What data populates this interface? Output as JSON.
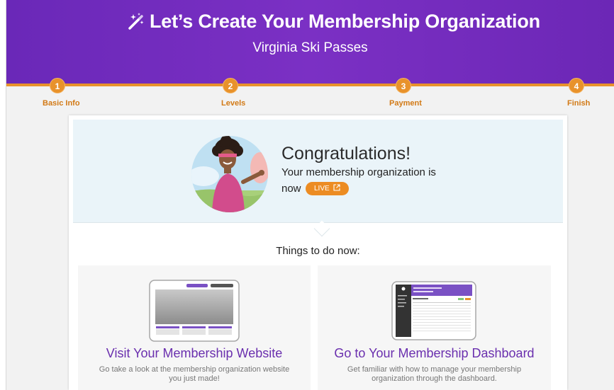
{
  "header": {
    "title": "Let’s Create Your Membership Organization",
    "subtitle": "Virginia Ski Passes",
    "title_icon": "magic-wand-icon"
  },
  "steps": [
    {
      "number": "1",
      "label": "Basic Info"
    },
    {
      "number": "2",
      "label": "Levels"
    },
    {
      "number": "3",
      "label": "Payment"
    },
    {
      "number": "4",
      "label": "Finish"
    }
  ],
  "hero": {
    "heading": "Congratulations!",
    "line1": "Your membership organization is",
    "line2_prefix": "now",
    "live_badge": "LIVE",
    "live_icon": "external-link-icon"
  },
  "next_steps": {
    "heading": "Things to do now:",
    "website": {
      "title": "Visit Your Membership Website",
      "description": "Go take a look at the membership organization website you just made!"
    },
    "dashboard": {
      "title": "Go to Your Membership Dashboard",
      "description": "Get familiar with how to manage your membership organization through the dashboard."
    }
  },
  "colors": {
    "header_purple": "#6a28b8",
    "accent_orange": "#e8922b",
    "link_purple": "#6a2fae",
    "hero_bg": "#eaf4f9"
  }
}
